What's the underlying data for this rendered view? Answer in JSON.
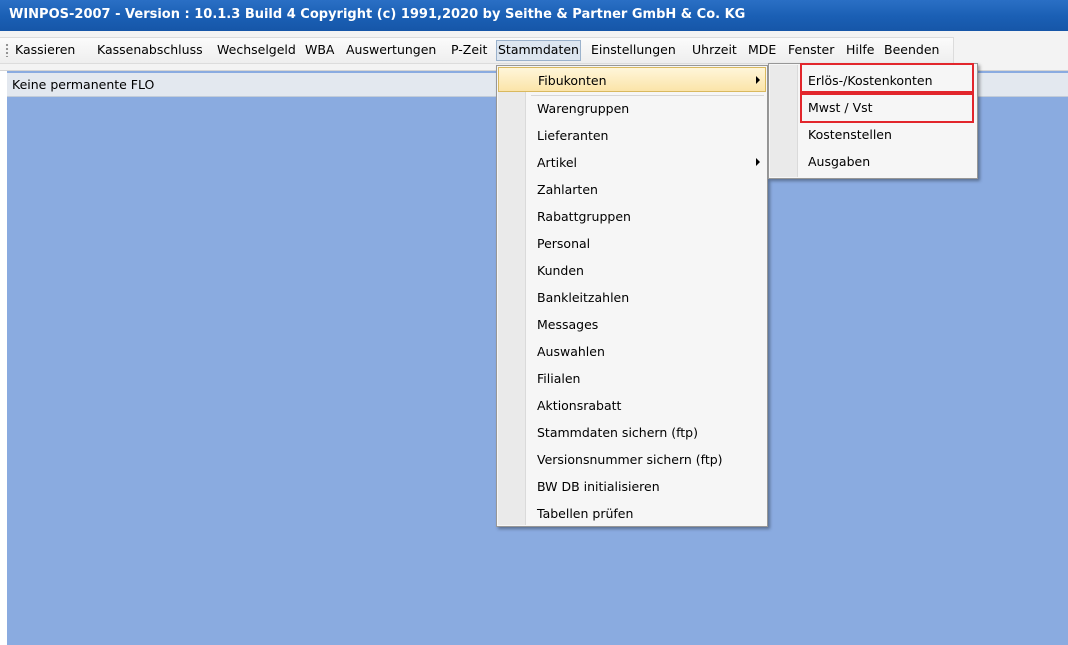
{
  "window": {
    "title": "WINPOS-2007  -  Version : 10.1.3 Build 4  Copyright (c) 1991,2020 by Seithe & Partner GmbH & Co. KG"
  },
  "menubar": {
    "items": [
      {
        "label": "Kassieren",
        "active": false
      },
      {
        "label": "Kassenabschluss",
        "active": false
      },
      {
        "label": "Wechselgeld",
        "active": false
      },
      {
        "label": "WBA",
        "active": false
      },
      {
        "label": "Auswertungen",
        "active": false
      },
      {
        "label": "P-Zeit",
        "active": false
      },
      {
        "label": "Stammdaten",
        "active": true
      },
      {
        "label": "Einstellungen",
        "active": false
      },
      {
        "label": "Uhrzeit",
        "active": false
      },
      {
        "label": "MDE",
        "active": false
      },
      {
        "label": "Fenster",
        "active": false
      },
      {
        "label": "Hilfe",
        "active": false
      },
      {
        "label": "Beenden",
        "active": false
      }
    ]
  },
  "status": {
    "text": "Keine permanente FLO"
  },
  "stammdaten_menu": {
    "items": [
      {
        "label": "Fibukonten",
        "has_submenu": true,
        "highlighted": true
      },
      {
        "label": "Warengruppen"
      },
      {
        "label": "Lieferanten"
      },
      {
        "label": "Artikel",
        "has_submenu": true
      },
      {
        "label": "Zahlarten"
      },
      {
        "label": "Rabattgruppen"
      },
      {
        "label": "Personal"
      },
      {
        "label": "Kunden"
      },
      {
        "label": "Bankleitzahlen"
      },
      {
        "label": "Messages"
      },
      {
        "label": "Auswahlen"
      },
      {
        "label": "Filialen"
      },
      {
        "label": "Aktionsrabatt"
      },
      {
        "label": "Stammdaten sichern (ftp)"
      },
      {
        "label": "Versionsnummer sichern (ftp)"
      },
      {
        "label": "BW DB initialisieren"
      },
      {
        "label": "Tabellen prüfen"
      }
    ]
  },
  "fibukonten_submenu": {
    "items": [
      {
        "label": "Erlös-/Kostenkonten",
        "annotated": true
      },
      {
        "label": "Mwst / Vst",
        "annotated": true
      },
      {
        "label": "Kostenstellen"
      },
      {
        "label": "Ausgaben"
      }
    ]
  },
  "colors": {
    "titlebar": "#1a5fb4",
    "client_area": "#8aabe0",
    "annotation_red": "#e2262c",
    "hover_item": "#fbe4a9"
  },
  "icons": [
    "chevron-right-icon",
    "toolbar-grip-icon"
  ]
}
